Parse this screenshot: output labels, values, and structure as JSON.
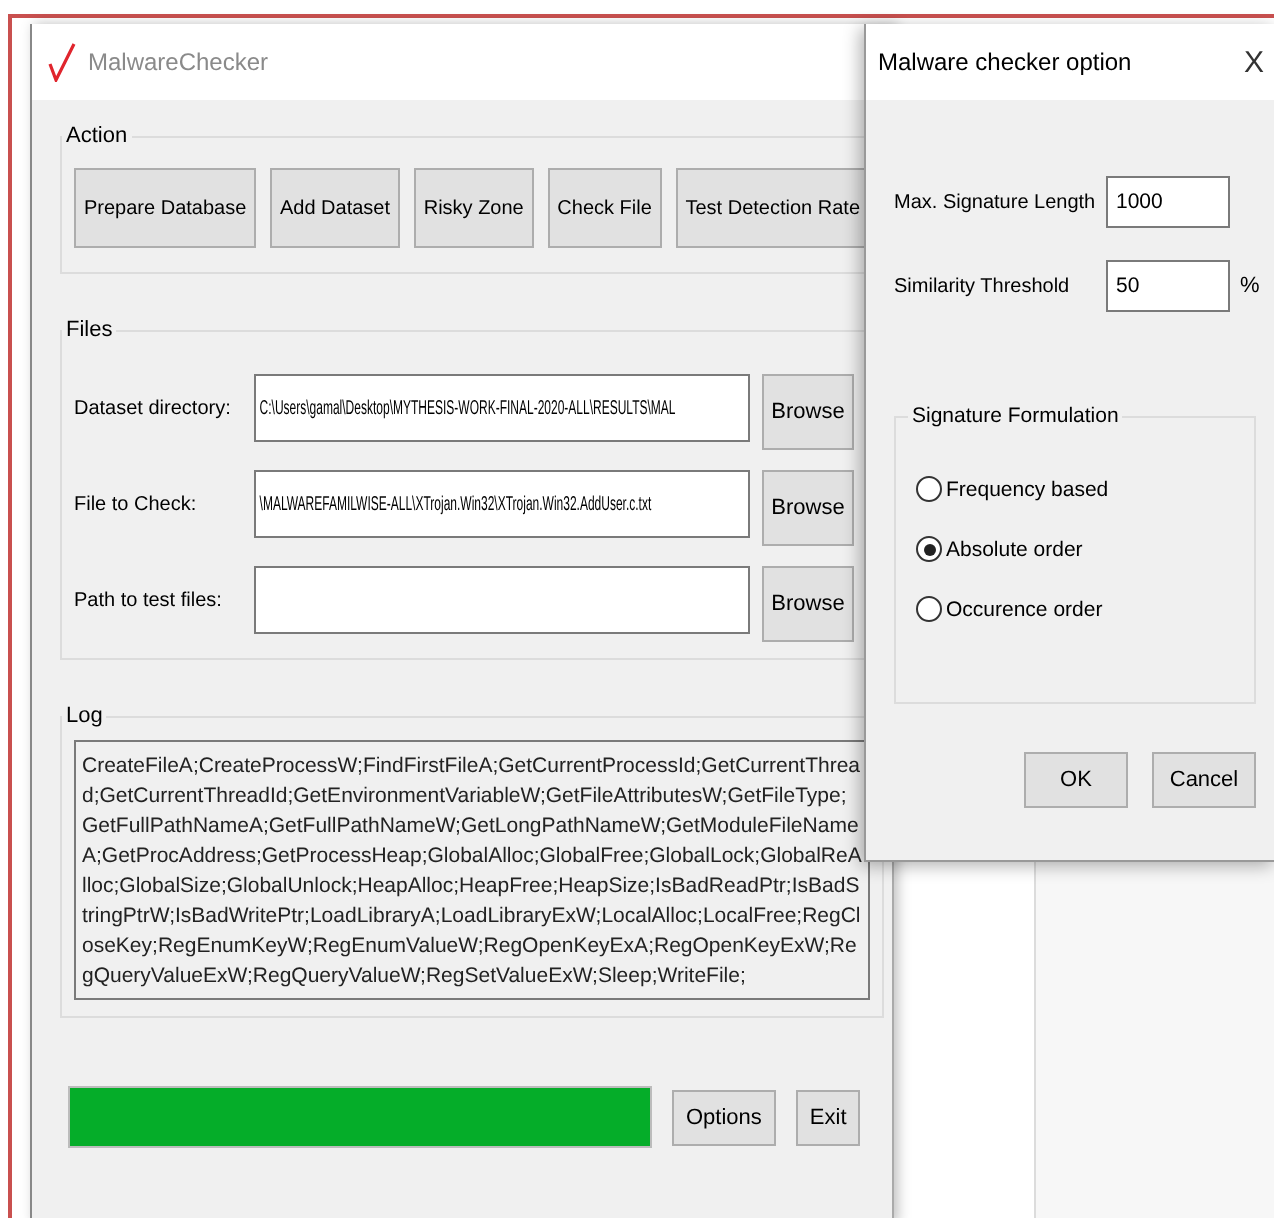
{
  "main_window": {
    "title": "MalwareChecker",
    "action_group": {
      "title": "Action",
      "buttons": [
        "Prepare Database",
        "Add Dataset",
        "Risky Zone",
        "Check File",
        "Test Detection Rate"
      ]
    },
    "files_group": {
      "title": "Files",
      "rows": [
        {
          "label": "Dataset directory:",
          "value": "C:\\Users\\gamal\\Desktop\\MYTHESIS-WORK-FINAL-2020-ALL\\RESULTS\\MAL",
          "button": "Browse"
        },
        {
          "label": "File to Check:",
          "value": "\\MALWAREFAMILWISE-ALL\\XTrojan.Win32\\XTrojan.Win32.AddUser.c.txt",
          "button": "Browse"
        },
        {
          "label": "Path to test files:",
          "button": "Browse"
        }
      ]
    },
    "log_group": {
      "title": "Log",
      "text": "CreateFileA;CreateProcessW;FindFirstFileA;GetCurrentProcessId;GetCurrentThread;GetCurrentThreadId;GetEnvironmentVariableW;GetFileAttributesW;GetFileType;GetFullPathNameA;GetFullPathNameW;GetLongPathNameW;GetModuleFileNameA;GetProcAddress;GetProcessHeap;GlobalAlloc;GlobalFree;GlobalLock;GlobalReAlloc;GlobalSize;GlobalUnlock;HeapAlloc;HeapFree;HeapSize;IsBadReadPtr;IsBadStringPtrW;IsBadWritePtr;LoadLibraryA;LoadLibraryExW;LocalAlloc;LocalFree;RegCloseKey;RegEnumKeyW;RegEnumValueW;RegOpenKeyExA;RegOpenKeyExW;RegQueryValueExW;RegQueryValueW;RegSetValueExW;Sleep;WriteFile;"
    },
    "progress": {
      "level": 1
    },
    "buttons": [
      "Options",
      "Exit"
    ]
  },
  "dialog": {
    "title": "Malware checker option",
    "close": "X",
    "fields": [
      {
        "label": "Max. Signature Length",
        "value": "1000"
      },
      {
        "label": "Similarity Threshold",
        "value": "50",
        "unit": "%"
      }
    ],
    "formulation": {
      "title": "Signature Formulation",
      "options": [
        {
          "label": "Frequency based",
          "selected": false
        },
        {
          "label": "Absolute order",
          "selected": true
        },
        {
          "label": "Occurence order",
          "selected": false
        }
      ]
    },
    "buttons": [
      "OK",
      "Cancel"
    ]
  }
}
